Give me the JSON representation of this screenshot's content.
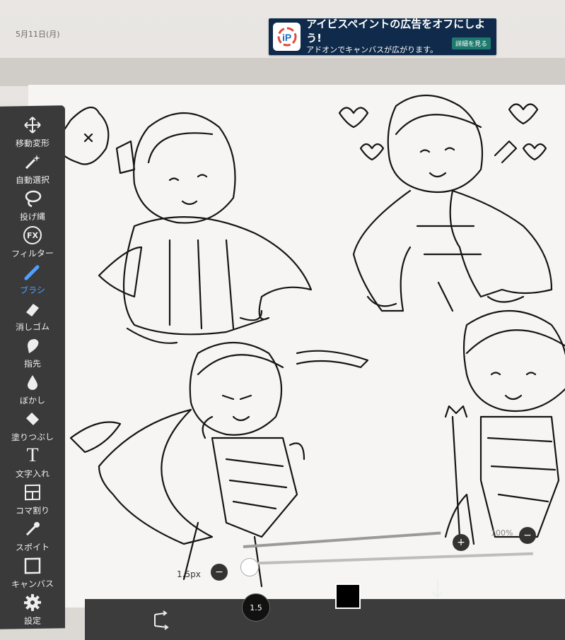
{
  "status": {
    "date": "5月11日(月)"
  },
  "ad": {
    "title": "アイビスペイントの広告をオフにしよう!",
    "subtitle": "アドオンでキャンバスが広がります。",
    "button": "詳細を見る",
    "logo_icon": "ibis-paint-logo-icon"
  },
  "toolbar": {
    "items": [
      {
        "label": "移動変形",
        "icon": "move-transform-icon"
      },
      {
        "label": "自動選択",
        "icon": "magic-wand-icon"
      },
      {
        "label": "投げ縄",
        "icon": "lasso-icon"
      },
      {
        "label": "フィルター",
        "icon": "fx-icon",
        "icon_text": "FX"
      },
      {
        "label": "ブラシ",
        "icon": "brush-icon"
      },
      {
        "label": "消しゴム",
        "icon": "eraser-icon"
      },
      {
        "label": "指先",
        "icon": "finger-smudge-icon"
      },
      {
        "label": "ぼかし",
        "icon": "blur-drop-icon"
      },
      {
        "label": "塗りつぶし",
        "icon": "fill-bucket-icon"
      },
      {
        "label": "文字入れ",
        "icon": "text-icon",
        "icon_text": "T"
      },
      {
        "label": "コマ割り",
        "icon": "panel-divide-icon"
      },
      {
        "label": "スポイト",
        "icon": "eyedropper-icon"
      },
      {
        "label": "キャンバス",
        "icon": "canvas-icon"
      },
      {
        "label": "設定",
        "icon": "gear-icon"
      }
    ],
    "active_color": "#4ea1ff"
  },
  "brush": {
    "size_label": "1.5px",
    "size_value": "1.5",
    "minus": "−",
    "plus": "+",
    "opacity_label": "100%"
  },
  "bottom_bar": {
    "color_swatch": "#000000",
    "undo_redo_icon": "transform-arrows-icon",
    "download_icon": "arrow-down-icon"
  }
}
